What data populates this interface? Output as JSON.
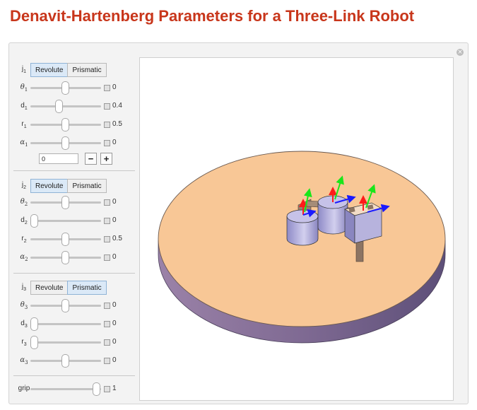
{
  "title": "Denavit-Hartenberg Parameters for a Three-Link Robot",
  "joints": [
    {
      "label": "j",
      "sub": "1",
      "modes": [
        "Revolute",
        "Prismatic"
      ],
      "selected_mode": "Revolute",
      "params": [
        {
          "label": "θ",
          "sub": "1",
          "value": "0",
          "fraction": 0.5,
          "button": "plus"
        },
        {
          "label": "d",
          "sub": "1",
          "value": "0.4",
          "fraction": 0.4,
          "button": "plus"
        },
        {
          "label": "r",
          "sub": "1",
          "value": "0.5",
          "fraction": 0.5,
          "button": "plus"
        },
        {
          "label": "α",
          "sub": "1",
          "value": "0",
          "fraction": 0.5,
          "button": "minus"
        }
      ],
      "input_value": "0",
      "minus_label": "−",
      "plus_label": "+"
    },
    {
      "label": "j",
      "sub": "2",
      "modes": [
        "Revolute",
        "Prismatic"
      ],
      "selected_mode": "Revolute",
      "params": [
        {
          "label": "θ",
          "sub": "2",
          "value": "0",
          "fraction": 0.5,
          "button": "plus"
        },
        {
          "label": "d",
          "sub": "2",
          "value": "0",
          "fraction": 0.0,
          "button": "plus"
        },
        {
          "label": "r",
          "sub": "2",
          "value": "0.5",
          "fraction": 0.5,
          "button": "plus"
        },
        {
          "label": "α",
          "sub": "2",
          "value": "0",
          "fraction": 0.5,
          "button": "plus"
        }
      ]
    },
    {
      "label": "j",
      "sub": "3",
      "modes": [
        "Revolute",
        "Prismatic"
      ],
      "selected_mode": "Prismatic",
      "params": [
        {
          "label": "θ",
          "sub": "3",
          "value": "0",
          "fraction": 0.5,
          "button": "plus"
        },
        {
          "label": "d",
          "sub": "3",
          "value": "0",
          "fraction": 0.0,
          "button": "plus"
        },
        {
          "label": "r",
          "sub": "3",
          "value": "0",
          "fraction": 0.0,
          "button": "plus"
        },
        {
          "label": "α",
          "sub": "3",
          "value": "0",
          "fraction": 0.5,
          "button": "plus"
        }
      ]
    }
  ],
  "grip": {
    "label": "grip",
    "value": "1",
    "fraction": 1.0
  },
  "colors": {
    "title": "#c8361b",
    "table_top": "#f8c796",
    "table_side": "#8a6f98",
    "axis_z": "#ff1a1a",
    "axis_x": "#1a1aff",
    "axis_y": "#1ae61a",
    "cylinder": "#b7b3dd",
    "link": "#8c7463"
  }
}
